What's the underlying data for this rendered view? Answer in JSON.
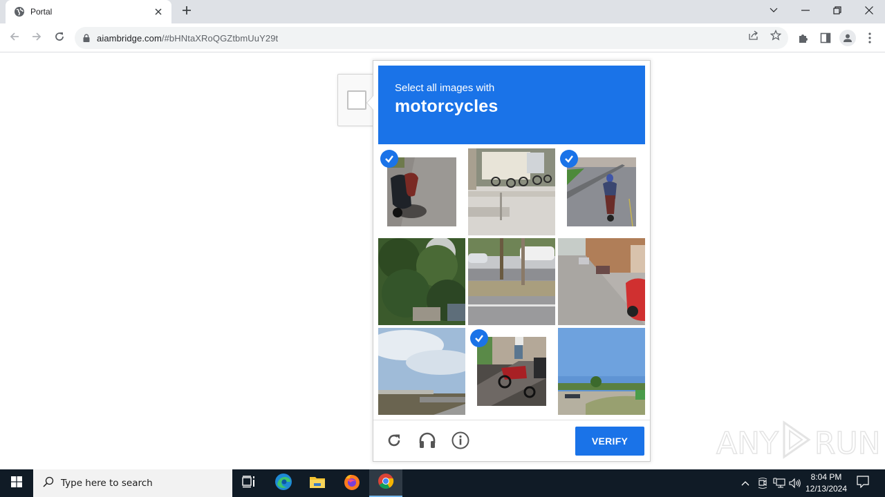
{
  "browser": {
    "tab_title": "Portal",
    "url_domain": "aiambridge.com",
    "url_path": "/#bHNtaXRoQGZtbmUuY29t",
    "icons": {
      "favicon": "globe-icon",
      "close_tab": "close-icon",
      "new_tab": "plus-icon",
      "back": "arrow-left-icon",
      "forward": "arrow-right-icon",
      "reload": "reload-icon",
      "lock": "lock-icon",
      "share": "share-icon",
      "bookmark": "star-icon",
      "extensions": "puzzle-icon",
      "side_panel": "side-panel-icon",
      "profile": "avatar-icon",
      "menu": "kebab-menu-icon"
    },
    "window_controls": [
      "tab-search",
      "minimize",
      "restore",
      "close"
    ]
  },
  "captcha": {
    "prompt_small": "Select all images with",
    "prompt_target": "motorcycles",
    "tiles": [
      {
        "index": 1,
        "description": "parked motorcycle on pavement",
        "selected": true
      },
      {
        "index": 2,
        "description": "bicycles and vans on street",
        "selected": false
      },
      {
        "index": 3,
        "description": "rider on motorcycle on road",
        "selected": true
      },
      {
        "index": 4,
        "description": "trees and foliage",
        "selected": false
      },
      {
        "index": 5,
        "description": "road with cars and trees",
        "selected": false
      },
      {
        "index": 6,
        "description": "street with parked red car",
        "selected": false
      },
      {
        "index": 7,
        "description": "sky with clouds over bridge",
        "selected": false
      },
      {
        "index": 8,
        "description": "red motorcycle near building",
        "selected": true
      },
      {
        "index": 9,
        "description": "open field with blue sky",
        "selected": false
      }
    ],
    "footer": {
      "reload_icon": "reload-icon",
      "audio_icon": "headphones-icon",
      "info_icon": "info-icon",
      "verify_label": "VERIFY"
    },
    "colors": {
      "accent": "#1a73e8"
    }
  },
  "watermark": {
    "left": "ANY",
    "right": "RUN"
  },
  "taskbar": {
    "search_placeholder": "Type here to search",
    "apps": [
      "task-view",
      "edge",
      "file-explorer",
      "firefox",
      "chrome"
    ],
    "active_app": "chrome",
    "time": "8:04 PM",
    "date": "12/13/2024"
  }
}
